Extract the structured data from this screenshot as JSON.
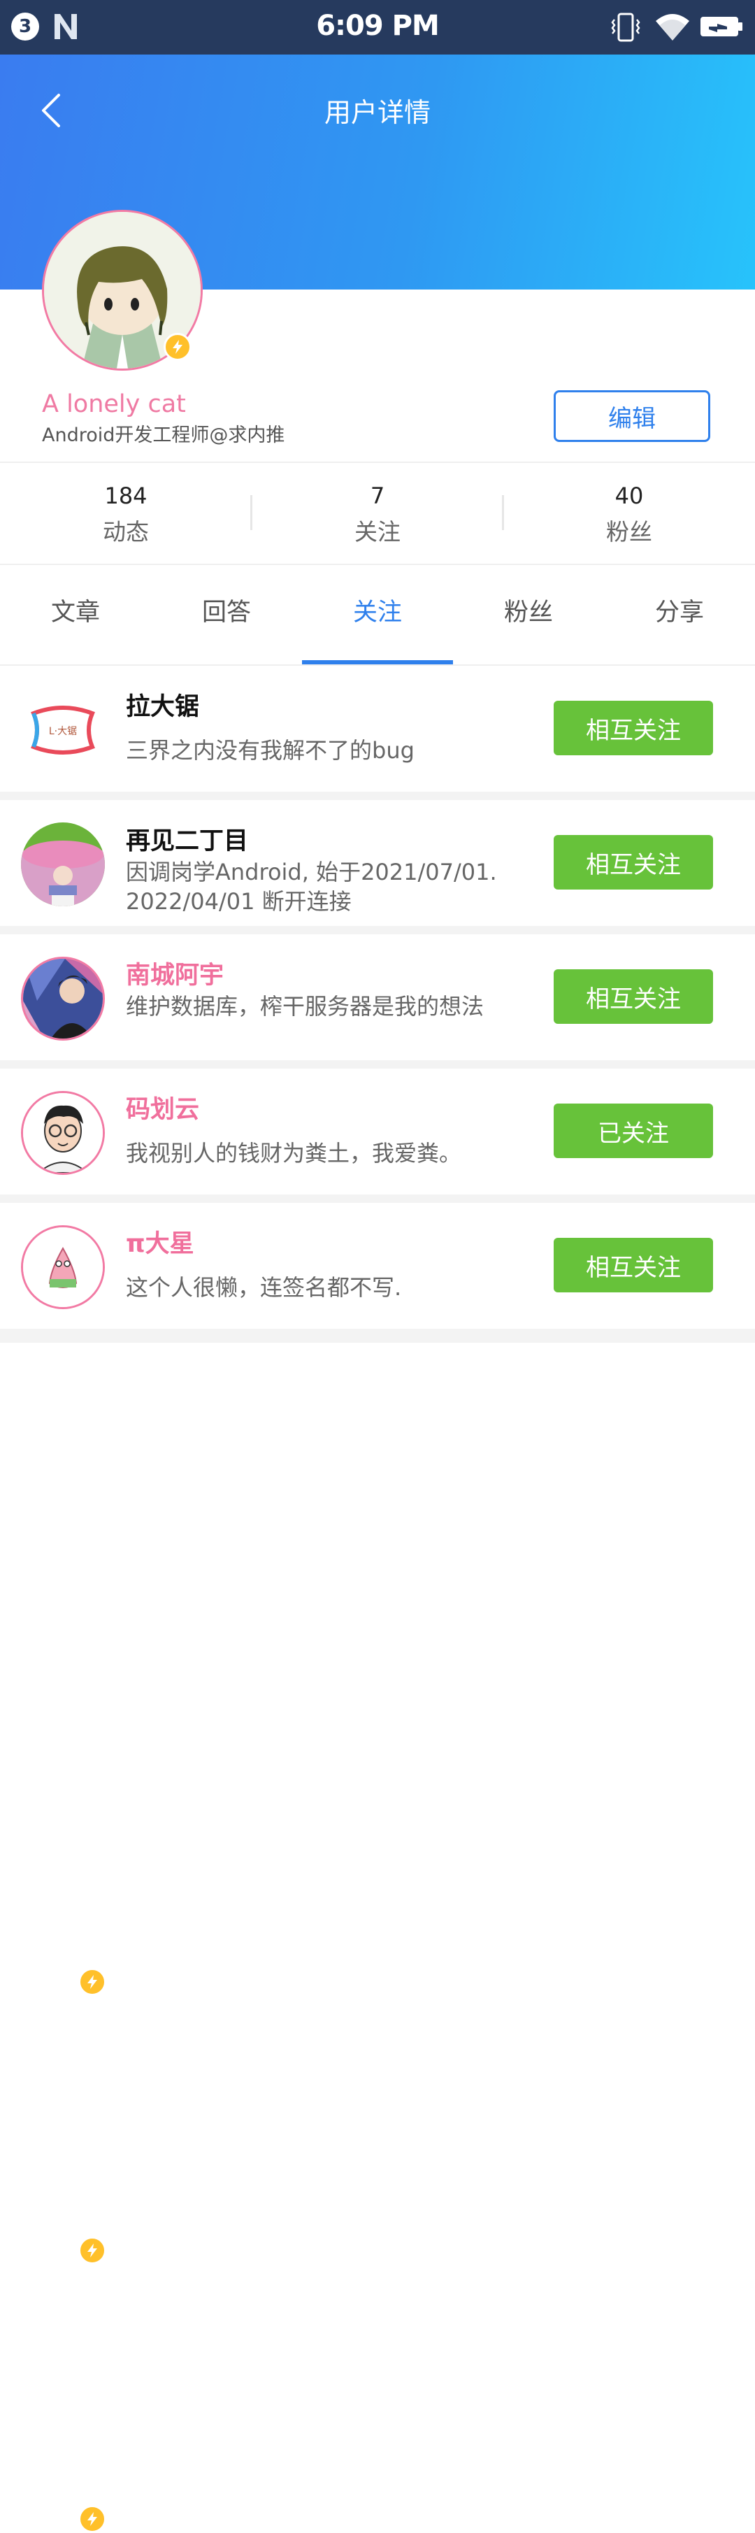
{
  "status_bar": {
    "notification_count": "3",
    "time": "6:09 PM",
    "icons": [
      "notification-count-icon",
      "n-app-icon",
      "vibrate-icon",
      "wifi-icon",
      "battery-charging-icon"
    ]
  },
  "header": {
    "title": "用户详情",
    "back_icon": "chevron-left-icon"
  },
  "profile": {
    "name": "A lonely cat",
    "bio": "Android开发工程师@求内推",
    "edit_label": "编辑"
  },
  "stats": [
    {
      "value": "184",
      "label": "动态"
    },
    {
      "value": "7",
      "label": "关注"
    },
    {
      "value": "40",
      "label": "粉丝"
    }
  ],
  "tabs": [
    {
      "label": "文章",
      "active": false
    },
    {
      "label": "回答",
      "active": false
    },
    {
      "label": "关注",
      "active": true
    },
    {
      "label": "粉丝",
      "active": false
    },
    {
      "label": "分享",
      "active": false
    }
  ],
  "following": [
    {
      "name": "拉大锯",
      "desc": "三界之内没有我解不了的bug",
      "button": "相互关注",
      "logo_text": "L·大锯"
    },
    {
      "name": "再见二丁目",
      "desc": "因调岗学Android, 始于2021/07/01. 2022/04/01 断开连接",
      "button": "相互关注"
    },
    {
      "name": "南城阿宇",
      "desc": "维护数据库，榨干服务器是我的想法",
      "button": "相互关注"
    },
    {
      "name": "码划云",
      "desc": "我视别人的钱财为粪土，我爱粪。",
      "button": "已关注"
    },
    {
      "name": "π大星",
      "desc": "这个人很懒，连签名都不写.",
      "button": "相互关注"
    }
  ],
  "colors": {
    "accent": "#2f80ec",
    "follow_green": "#67c23a",
    "vip_pink": "#f06f9c",
    "badge_yellow": "#ffc02a"
  }
}
